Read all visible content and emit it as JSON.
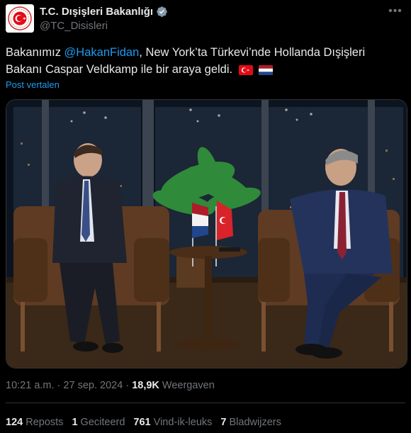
{
  "account": {
    "display_name": "T.C. Dışişleri Bakanlığı",
    "handle": "@TC_Disisleri"
  },
  "tweet": {
    "text_part1": "Bakanımız ",
    "mention": "@HakanFidan",
    "text_part2": ", New York’ta Türkevi’nde Hollanda Dışişleri",
    "text_line2": "Bakanı Caspar Veldkamp ile bir araya geldi.",
    "translate_label": "Post vertalen"
  },
  "meta": {
    "time": "10:21 a.m.",
    "separator": "·",
    "date": "27 sep. 2024",
    "views_count": "18,9K",
    "views_label": "Weergaven"
  },
  "stats": {
    "reposts_count": "124",
    "reposts_label": "Reposts",
    "quotes_count": "1",
    "quotes_label": "Geciteerd",
    "likes_count": "761",
    "likes_label": "Vind-ik-leuks",
    "bookmarks_count": "7",
    "bookmarks_label": "Bladwijzers"
  },
  "colors": {
    "accent": "#1d9bf0",
    "verified_badge": "#829aab",
    "background": "#000000"
  },
  "icons": [
    "turkish-ministry-logo",
    "verified-badge-icon",
    "more-icon",
    "turkey-flag-icon",
    "netherlands-flag-icon"
  ]
}
